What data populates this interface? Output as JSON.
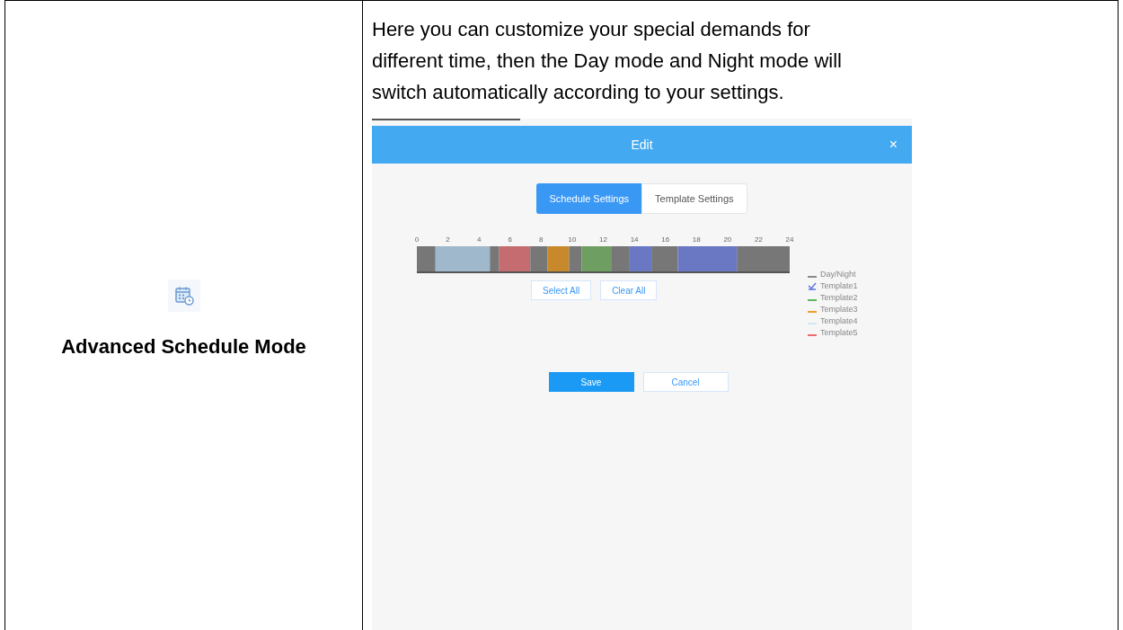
{
  "feature": {
    "title": "Advanced Schedule Mode"
  },
  "description": "Here you can customize your special demands for different time, then the Day mode and Night mode will switch automatically according to your settings.",
  "dialog": {
    "title": "Edit",
    "close": "×",
    "tabs": [
      {
        "label": "Schedule Settings",
        "selected": true
      },
      {
        "label": "Template Settings",
        "selected": false
      }
    ],
    "timeline": {
      "chart_data": {
        "type": "bar",
        "orientation": "horizontal",
        "stacked": true,
        "xlim": [
          0,
          24
        ],
        "xticks": [
          0,
          2,
          4,
          6,
          8,
          10,
          12,
          14,
          16,
          18,
          20,
          22,
          24
        ],
        "series": [
          {
            "color": "#777777",
            "values": [
              1.2
            ]
          },
          {
            "color": "#9fb8cc",
            "values": [
              3.5
            ]
          },
          {
            "color": "#777777",
            "values": [
              0.6
            ]
          },
          {
            "color": "#c46c70",
            "values": [
              2.0
            ]
          },
          {
            "color": "#777777",
            "values": [
              1.1
            ]
          },
          {
            "color": "#c8892c",
            "values": [
              1.4
            ]
          },
          {
            "color": "#777777",
            "values": [
              0.8
            ]
          },
          {
            "color": "#6f9e62",
            "values": [
              1.9
            ]
          },
          {
            "color": "#777777",
            "values": [
              1.2
            ]
          },
          {
            "color": "#6a78c4",
            "values": [
              1.4
            ]
          },
          {
            "color": "#777777",
            "values": [
              1.7
            ]
          },
          {
            "color": "#6a78c4",
            "values": [
              3.8
            ]
          },
          {
            "color": "#777777",
            "values": [
              3.4
            ]
          }
        ]
      }
    },
    "legend": [
      {
        "label": "Day/Night",
        "color": "#8a8a8a",
        "selected": false
      },
      {
        "label": "Template1",
        "color": "#5b6fe0",
        "selected": true
      },
      {
        "label": "Template2",
        "color": "#5cb85c",
        "selected": false
      },
      {
        "label": "Template3",
        "color": "#f0a030",
        "selected": false
      },
      {
        "label": "Template4",
        "color": "#cfe8f8",
        "selected": false
      },
      {
        "label": "Template5",
        "color": "#ef6b6b",
        "selected": false
      }
    ],
    "select_buttons": [
      "Select All",
      "Clear All"
    ],
    "actions": [
      {
        "label": "Save",
        "kind": "primary"
      },
      {
        "label": "Cancel",
        "kind": "secondary"
      }
    ]
  }
}
